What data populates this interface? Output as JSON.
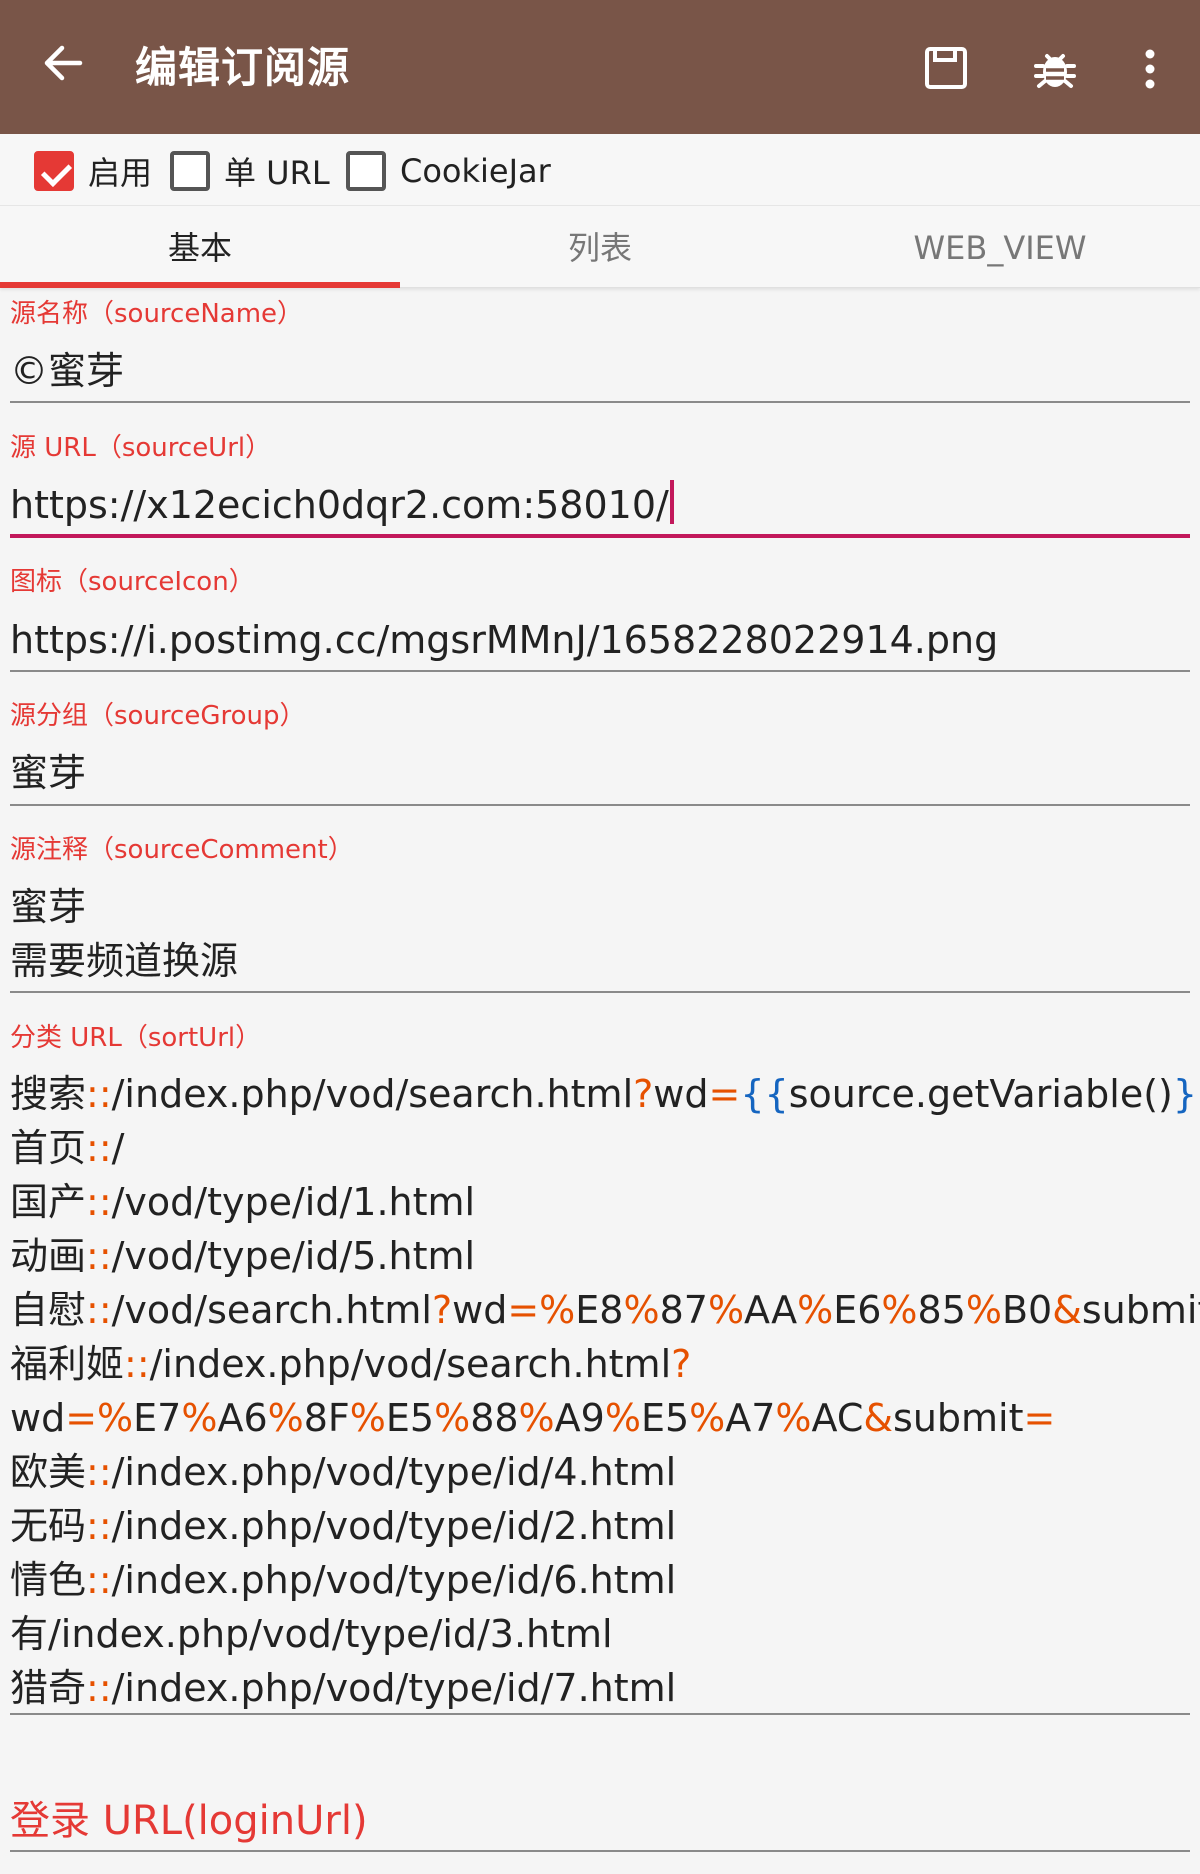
{
  "appbar": {
    "title": "编辑订阅源",
    "icons": [
      "back-arrow-icon",
      "save-icon",
      "bug-icon",
      "more-vert-icon"
    ]
  },
  "options": {
    "enabled_label": "启用",
    "enabled_checked": true,
    "single_url_label": "单 URL",
    "single_url_checked": false,
    "cookiejar_label": "CookieJar",
    "cookiejar_checked": false
  },
  "tabs": [
    {
      "label": "基本",
      "active": true
    },
    {
      "label": "列表",
      "active": false
    },
    {
      "label": "WEB_VIEW",
      "active": false
    }
  ],
  "fields": {
    "source_name": {
      "label": "源名称（sourceName）",
      "value": "©蜜芽"
    },
    "source_url": {
      "label": "源 URL（sourceUrl）",
      "value": "https://x12ecich0dqr2.com:58010/"
    },
    "source_icon": {
      "label": "图标（sourceIcon）",
      "value": "https://i.postimg.cc/mgsrMMnJ/1658228022914.png"
    },
    "source_group": {
      "label": "源分组（sourceGroup）",
      "value": "蜜芽"
    },
    "source_comment": {
      "label": "源注释（sourceComment）",
      "value": "蜜芽\n需要频道换源"
    },
    "sort_url": {
      "label": "分类 URL（sortUrl）",
      "lines": [
        [
          {
            "t": "搜索",
            "c": ""
          },
          {
            "t": "::",
            "c": "o"
          },
          {
            "t": "/index.php/vod/search.html",
            "c": ""
          },
          {
            "t": "?",
            "c": "o"
          },
          {
            "t": "wd",
            "c": ""
          },
          {
            "t": "=",
            "c": "o"
          },
          {
            "t": "{{",
            "c": "b"
          },
          {
            "t": "source.getVariable()",
            "c": ""
          },
          {
            "t": "}}",
            "c": "b"
          }
        ],
        [
          {
            "t": "首页",
            "c": ""
          },
          {
            "t": "::",
            "c": "o"
          },
          {
            "t": "/",
            "c": ""
          }
        ],
        [
          {
            "t": "国产",
            "c": ""
          },
          {
            "t": "::",
            "c": "o"
          },
          {
            "t": "/vod/type/id/1.html",
            "c": ""
          }
        ],
        [
          {
            "t": "动画",
            "c": ""
          },
          {
            "t": "::",
            "c": "o"
          },
          {
            "t": "/vod/type/id/5.html",
            "c": ""
          }
        ],
        [
          {
            "t": "自慰",
            "c": ""
          },
          {
            "t": "::",
            "c": "o"
          },
          {
            "t": "/vod/search.html",
            "c": ""
          },
          {
            "t": "?",
            "c": "o"
          },
          {
            "t": "wd",
            "c": ""
          },
          {
            "t": "=%",
            "c": "o"
          },
          {
            "t": "E8",
            "c": ""
          },
          {
            "t": "%",
            "c": "o"
          },
          {
            "t": "87",
            "c": ""
          },
          {
            "t": "%",
            "c": "o"
          },
          {
            "t": "AA",
            "c": ""
          },
          {
            "t": "%",
            "c": "o"
          },
          {
            "t": "E6",
            "c": ""
          },
          {
            "t": "%",
            "c": "o"
          },
          {
            "t": "85",
            "c": ""
          },
          {
            "t": "%",
            "c": "o"
          },
          {
            "t": "B0",
            "c": ""
          },
          {
            "t": "&",
            "c": "o"
          },
          {
            "t": "submit",
            "c": ""
          },
          {
            "t": "=",
            "c": "o"
          }
        ],
        [
          {
            "t": "福利姬",
            "c": ""
          },
          {
            "t": "::",
            "c": "o"
          },
          {
            "t": "/index.php/vod/search.html",
            "c": ""
          },
          {
            "t": "?",
            "c": "o"
          }
        ],
        [
          {
            "t": "wd",
            "c": ""
          },
          {
            "t": "=%",
            "c": "o"
          },
          {
            "t": "E7",
            "c": ""
          },
          {
            "t": "%",
            "c": "o"
          },
          {
            "t": "A6",
            "c": ""
          },
          {
            "t": "%",
            "c": "o"
          },
          {
            "t": "8F",
            "c": ""
          },
          {
            "t": "%",
            "c": "o"
          },
          {
            "t": "E5",
            "c": ""
          },
          {
            "t": "%",
            "c": "o"
          },
          {
            "t": "88",
            "c": ""
          },
          {
            "t": "%",
            "c": "o"
          },
          {
            "t": "A9",
            "c": ""
          },
          {
            "t": "%",
            "c": "o"
          },
          {
            "t": "E5",
            "c": ""
          },
          {
            "t": "%",
            "c": "o"
          },
          {
            "t": "A7",
            "c": ""
          },
          {
            "t": "%",
            "c": "o"
          },
          {
            "t": "AC",
            "c": ""
          },
          {
            "t": "&",
            "c": "o"
          },
          {
            "t": "submit",
            "c": ""
          },
          {
            "t": "=",
            "c": "o"
          }
        ],
        [
          {
            "t": "欧美",
            "c": ""
          },
          {
            "t": "::",
            "c": "o"
          },
          {
            "t": "/index.php/vod/type/id/4.html",
            "c": ""
          }
        ],
        [
          {
            "t": "无码",
            "c": ""
          },
          {
            "t": "::",
            "c": "o"
          },
          {
            "t": "/index.php/vod/type/id/2.html",
            "c": ""
          }
        ],
        [
          {
            "t": "情色",
            "c": ""
          },
          {
            "t": "::",
            "c": "o"
          },
          {
            "t": "/index.php/vod/type/id/6.html",
            "c": ""
          }
        ],
        [
          {
            "t": "有/index.php/vod/type/id/3.html",
            "c": ""
          }
        ],
        [
          {
            "t": "猎奇",
            "c": ""
          },
          {
            "t": "::",
            "c": "o"
          },
          {
            "t": "/index.php/vod/type/id/7.html",
            "c": ""
          }
        ]
      ]
    },
    "login_url": {
      "label": "登录 URL(loginUrl)"
    }
  },
  "colors": {
    "appbar": "#795548",
    "accent": "#e53935",
    "focus_underline": "#c2185b",
    "syntax_orange": "#e65100",
    "syntax_blue": "#1565c0"
  }
}
